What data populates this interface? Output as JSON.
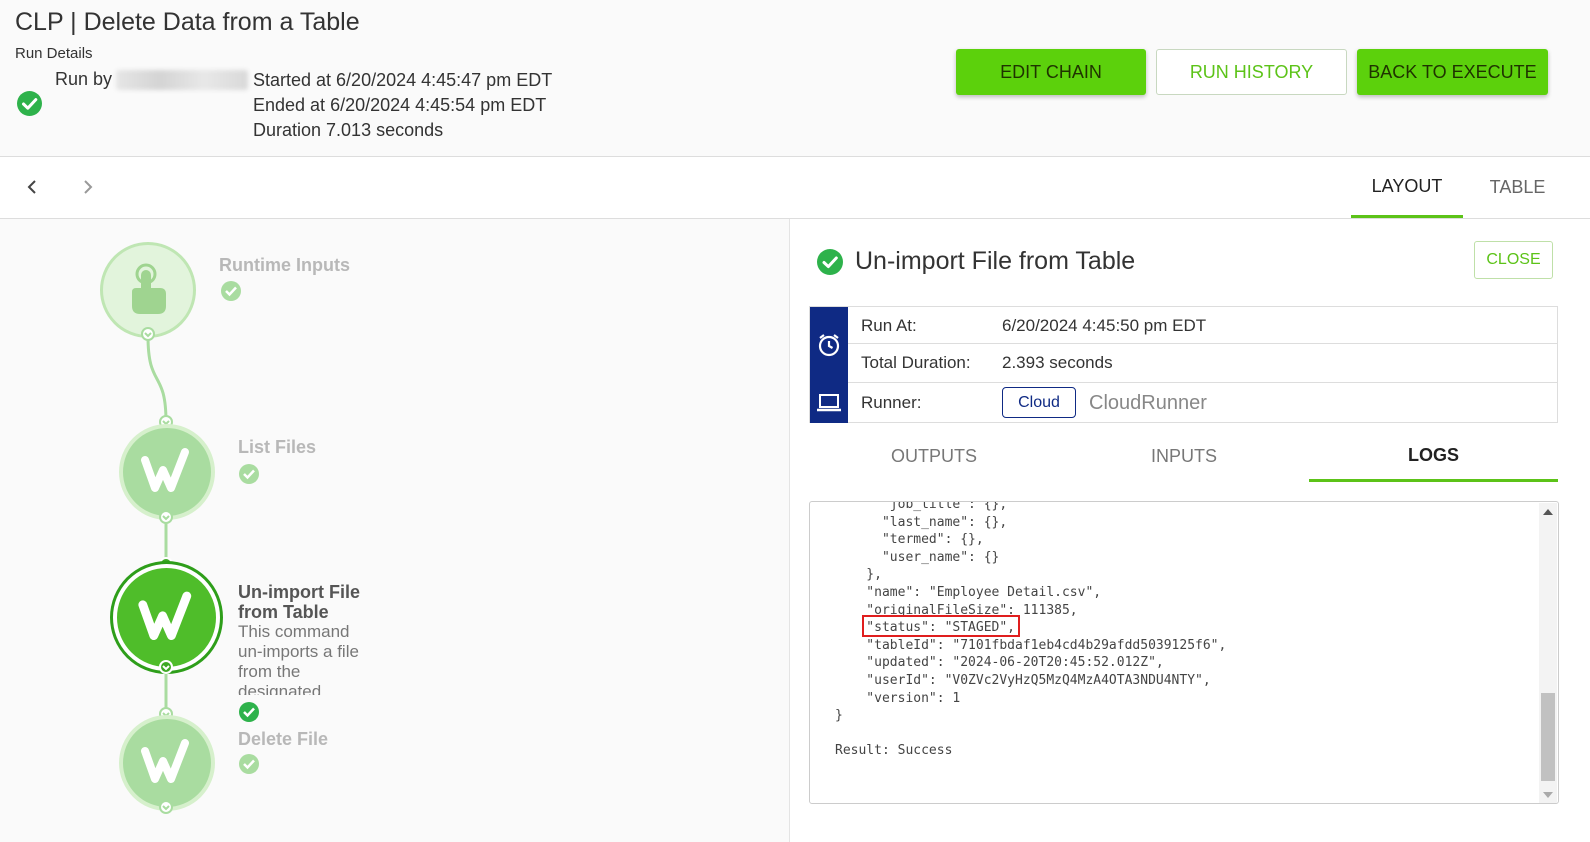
{
  "header": {
    "title": "CLP | Delete Data from a Table",
    "run_details_label": "Run Details",
    "run_by_label": "Run by",
    "started": "Started at 6/20/2024 4:45:47 pm EDT",
    "ended": "Ended at 6/20/2024 4:45:54 pm EDT",
    "duration": "Duration 7.013 seconds",
    "buttons": {
      "edit_chain": "EDIT CHAIN",
      "run_history": "RUN HISTORY",
      "back_to_execute": "BACK TO EXECUTE"
    }
  },
  "subnav": {
    "tabs": [
      "LAYOUT",
      "TABLE"
    ],
    "active_tab": "LAYOUT"
  },
  "flow": {
    "nodes": [
      {
        "label": "Runtime Inputs",
        "icon": "hand-pointer-icon",
        "status": "success"
      },
      {
        "label": "List Files",
        "icon": "workiva-w-icon",
        "status": "success"
      },
      {
        "label_line1": "Un-import File",
        "label_line2": "from Table",
        "description": "This command un-imports a file from the designated",
        "icon": "workiva-w-icon",
        "status": "success",
        "selected": true
      },
      {
        "label": "Delete File",
        "icon": "workiva-w-icon",
        "status": "success"
      }
    ]
  },
  "panel": {
    "title": "Un-import File from Table",
    "close_label": "CLOSE",
    "run_at_label": "Run At:",
    "run_at_value": "6/20/2024 4:45:50 pm EDT",
    "total_duration_label": "Total Duration:",
    "total_duration_value": "2.393 seconds",
    "runner_label": "Runner:",
    "runner_chip": "Cloud",
    "runner_name": "CloudRunner",
    "tabs": [
      "OUTPUTS",
      "INPUTS",
      "LOGS"
    ],
    "active_tab": "LOGS",
    "log_text": "      \"job_title\": {},\n      \"last_name\": {},\n      \"termed\": {},\n      \"user_name\": {}\n    },\n    \"name\": \"Employee Detail.csv\",\n    \"originalFileSize\": 111385,\n    \"status\": \"STAGED\",\n    \"tableId\": \"7101fbdaf1eb4cd4b29afdd5039125f6\",\n    \"updated\": \"2024-06-20T20:45:52.012Z\",\n    \"userId\": \"V0ZVc2VyHzQ5MzQ4MzA4OTA3NDU4NTY\",\n    \"version\": 1\n}\n\nResult: Success"
  },
  "colors": {
    "accent_green": "#5cd10c",
    "success_green": "#2eb24b",
    "navy": "#0f2a84",
    "highlight_red": "#e01e1e"
  }
}
